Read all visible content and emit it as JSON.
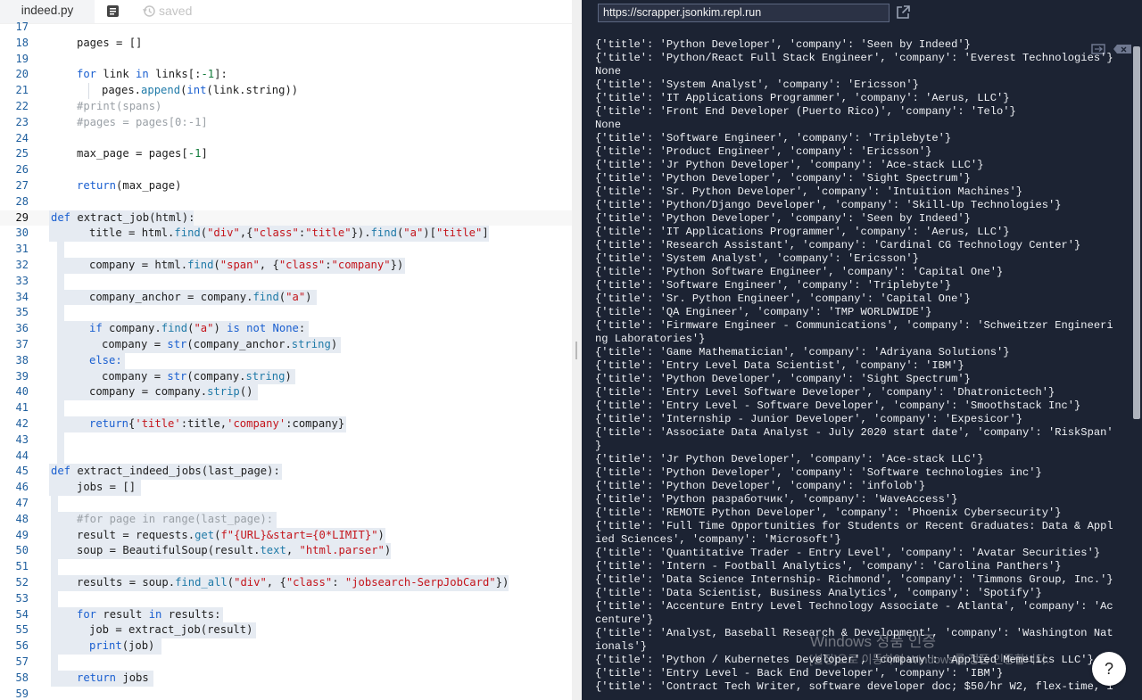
{
  "editor": {
    "file_tab": "indeed.py",
    "saved_label": "saved",
    "line_numbers": [
      "17",
      "18",
      "19",
      "20",
      "21",
      "22",
      "23",
      "24",
      "25",
      "26",
      "27",
      "28",
      "29",
      "30",
      "31",
      "32",
      "33",
      "34",
      "35",
      "36",
      "37",
      "38",
      "39",
      "40",
      "41",
      "42",
      "43",
      "44",
      "45",
      "46",
      "47",
      "48",
      "49",
      "50",
      "51",
      "52",
      "53",
      "54",
      "55",
      "56",
      "57",
      "58",
      "59"
    ],
    "current_line": "29"
  },
  "code": {
    "l18": "pages = []",
    "l20a": "for",
    "l20b": " link ",
    "l20c": "in",
    "l20d": " links[:",
    "l20e": "-1",
    "l20f": "]:",
    "l21a": "pages.",
    "l21b": "append",
    "l21c": "(",
    "l21d": "int",
    "l21e": "(link.string))",
    "l22": "#print(spans)",
    "l23": "#pages = pages[0:-1]",
    "l25a": "max_page = pages[",
    "l25b": "-1",
    "l25c": "]",
    "l27a": "return",
    "l27b": "(max_page)",
    "l29a": "def",
    "l29b": " extract_job(html):",
    "l30a": "title = html.",
    "l30b": "find",
    "l30c": "(",
    "l30d": "\"div\"",
    "l30e": ",{",
    "l30f": "\"class\"",
    "l30g": ":",
    "l30h": "\"title\"",
    "l30i": "}).",
    "l30j": "find",
    "l30k": "(",
    "l30l": "\"a\"",
    "l30m": ")[",
    "l30n": "\"title\"",
    "l30o": "]",
    "l32a": "company = html.",
    "l32b": "find",
    "l32c": "(",
    "l32d": "\"span\"",
    "l32e": ", {",
    "l32f": "\"class\"",
    "l32g": ":",
    "l32h": "\"company\"",
    "l32i": "})",
    "l34a": "company_anchor = company.",
    "l34b": "find",
    "l34c": "(",
    "l34d": "\"a\"",
    "l34e": ")",
    "l36a": "if",
    "l36b": " company.",
    "l36c": "find",
    "l36d": "(",
    "l36e": "\"a\"",
    "l36f": ") ",
    "l36g": "is not",
    "l36h": " ",
    "l36i": "None",
    "l36j": ":",
    "l37a": "company = ",
    "l37b": "str",
    "l37c": "(company_anchor.",
    "l37d": "string",
    "l37e": ")",
    "l38": "else:",
    "l39a": "company = ",
    "l39b": "str",
    "l39c": "(company.",
    "l39d": "string",
    "l39e": ")",
    "l40a": "company = company.",
    "l40b": "strip",
    "l40c": "()",
    "l42a": "return",
    "l42b": "{",
    "l42c": "'title'",
    "l42d": ":title,",
    "l42e": "'company'",
    "l42f": ":company}",
    "l45a": "def",
    "l45b": " extract_indeed_jobs(last_page):",
    "l46": "jobs = []",
    "l48": "#for page in range(last_page):",
    "l49a": "result = requests.",
    "l49b": "get",
    "l49c": "(",
    "l49d": "f\"{URL}&start={0*LIMIT}\"",
    "l49e": ")",
    "l50a": "soup = BeautifulSoup(result.",
    "l50b": "text",
    "l50c": ", ",
    "l50d": "\"html.parser\"",
    "l50e": ")",
    "l52a": "results = soup.",
    "l52b": "find_all",
    "l52c": "(",
    "l52d": "\"div\"",
    "l52e": ", {",
    "l52f": "\"class\"",
    "l52g": ": ",
    "l52h": "\"jobsearch-SerpJobCard\"",
    "l52i": "})",
    "l54a": "for",
    "l54b": " result ",
    "l54c": "in",
    "l54d": " results:",
    "l55": "job = extract_job(result)",
    "l56a": "print",
    "l56b": "(job)",
    "l58a": "return",
    "l58b": " jobs"
  },
  "console": {
    "url": "https://scrapper.jsonkim.repl.run",
    "output": [
      "{'title': 'Python Developer', 'company': 'Seen by Indeed'}",
      "{'title': 'Python/React Full Stack Engineer', 'company': 'Everest Technologies'}",
      "None",
      "{'title': 'System Analyst', 'company': 'Ericsson'}",
      "{'title': 'IT Applications Programmer', 'company': 'Aerus, LLC'}",
      "{'title': 'Front End Developer (Puerto Rico)', 'company': 'Telo'}",
      "None",
      "{'title': 'Software Engineer', 'company': 'Triplebyte'}",
      "{'title': 'Product Engineer', 'company': 'Ericsson'}",
      "{'title': 'Jr Python Developer', 'company': 'Ace-stack LLC'}",
      "{'title': 'Python Developer', 'company': 'Sight Spectrum'}",
      "{'title': 'Sr. Python Developer', 'company': 'Intuition Machines'}",
      "{'title': 'Python/Django Developer', 'company': 'Skill-Up Technologies'}",
      "{'title': 'Python Developer', 'company': 'Seen by Indeed'}",
      "{'title': 'IT Applications Programmer', 'company': 'Aerus, LLC'}",
      "{'title': 'Research Assistant', 'company': 'Cardinal CG Technology Center'}",
      "{'title': 'System Analyst', 'company': 'Ericsson'}",
      "{'title': 'Python Software Engineer', 'company': 'Capital One'}",
      "{'title': 'Software Engineer', 'company': 'Triplebyte'}",
      "{'title': 'Sr. Python Engineer', 'company': 'Capital One'}",
      "{'title': 'QA Engineer', 'company': 'TMP WORLDWIDE'}",
      "{'title': 'Firmware Engineer - Communications', 'company': 'Schweitzer Engineeri",
      "ng Laboratories'}",
      "{'title': 'Game Mathematician', 'company': 'Adriyana Solutions'}",
      "{'title': 'Entry Level Data Scientist', 'company': 'IBM'}",
      "{'title': 'Python Developer', 'company': 'Sight Spectrum'}",
      "{'title': 'Entry Level Software Developer', 'company': 'Dhatronictech'}",
      "{'title': 'Entry Level - Software Developer', 'company': 'Smoothstack Inc'}",
      "{'title': 'Internship - Junior Developer', 'company': 'Expesicor'}",
      "{'title': 'Associate Data Analyst - July 2020 start date', 'company': 'RiskSpan'",
      "}",
      "{'title': 'Jr Python Developer', 'company': 'Ace-stack LLC'}",
      "{'title': 'Python Developer', 'company': 'Software technologies inc'}",
      "{'title': 'Python Developer', 'company': 'infolob'}",
      "{'title': 'Python разработчик', 'company': 'WaveAccess'}",
      "{'title': 'REMOTE Python Developer', 'company': 'Phoenix Cybersecurity'}",
      "{'title': 'Full Time Opportunities for Students or Recent Graduates: Data & Appl",
      "ied Sciences', 'company': 'Microsoft'}",
      "{'title': 'Quantitative Trader - Entry Level', 'company': 'Avatar Securities'}",
      "{'title': 'Intern - Football Analytics', 'company': 'Carolina Panthers'}",
      "{'title': 'Data Science Internship- Richmond', 'company': 'Timmons Group, Inc.'}",
      "{'title': 'Data Scientist, Business Analytics', 'company': 'Spotify'}",
      "{'title': 'Accenture Entry Level Technology Associate - Atlanta', 'company': 'Ac",
      "centure'}",
      "{'title': 'Analyst, Baseball Research & Development', 'company': 'Washington Nat",
      "ionals'}",
      "{'title': 'Python / Kubernetes Developer', 'company': 'Applied Memetics LLC'}",
      "{'title': 'Entry Level - Back End Developer', 'company': 'IBM'}",
      "{'title': 'Contract Tech Writer, software developer doc; $50/hr W2, flex-time, 1"
    ],
    "help_label": "?"
  },
  "watermark": {
    "line1": "Windows 정품 인증",
    "line2": "[설정]으로 이동하여 Windows를 정품 인증합니다."
  }
}
